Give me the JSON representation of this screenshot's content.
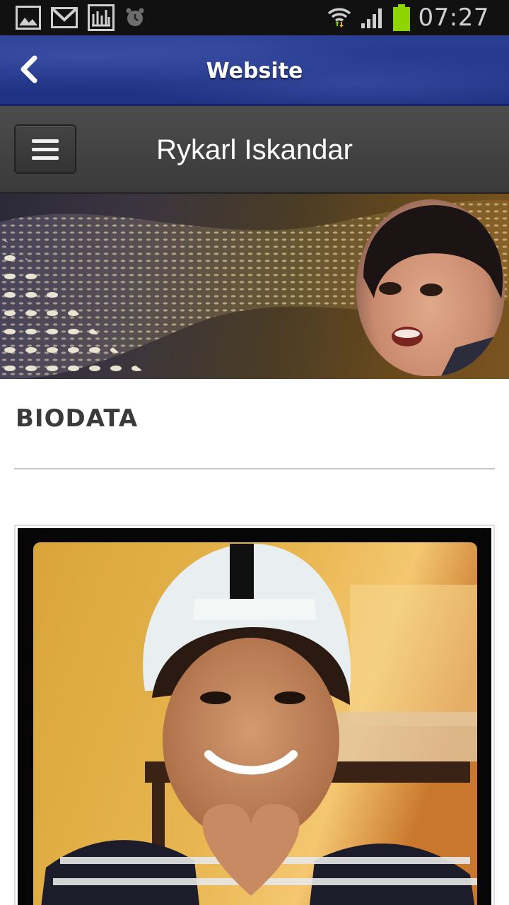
{
  "status_bar": {
    "time": "07:27",
    "icons": [
      "gallery-icon",
      "gmail-icon",
      "prayer-times-icon",
      "alarm-icon",
      "wifi-icon",
      "signal-icon",
      "battery-icon"
    ],
    "battery_color": "#8ed400"
  },
  "app_bar": {
    "title": "Website",
    "back_icon": "chevron-left-icon",
    "color": "#243789"
  },
  "site_header": {
    "name": "Rykarl Iskandar",
    "menu_icon": "hamburger-icon"
  },
  "content": {
    "section_title": "BIODATA"
  }
}
